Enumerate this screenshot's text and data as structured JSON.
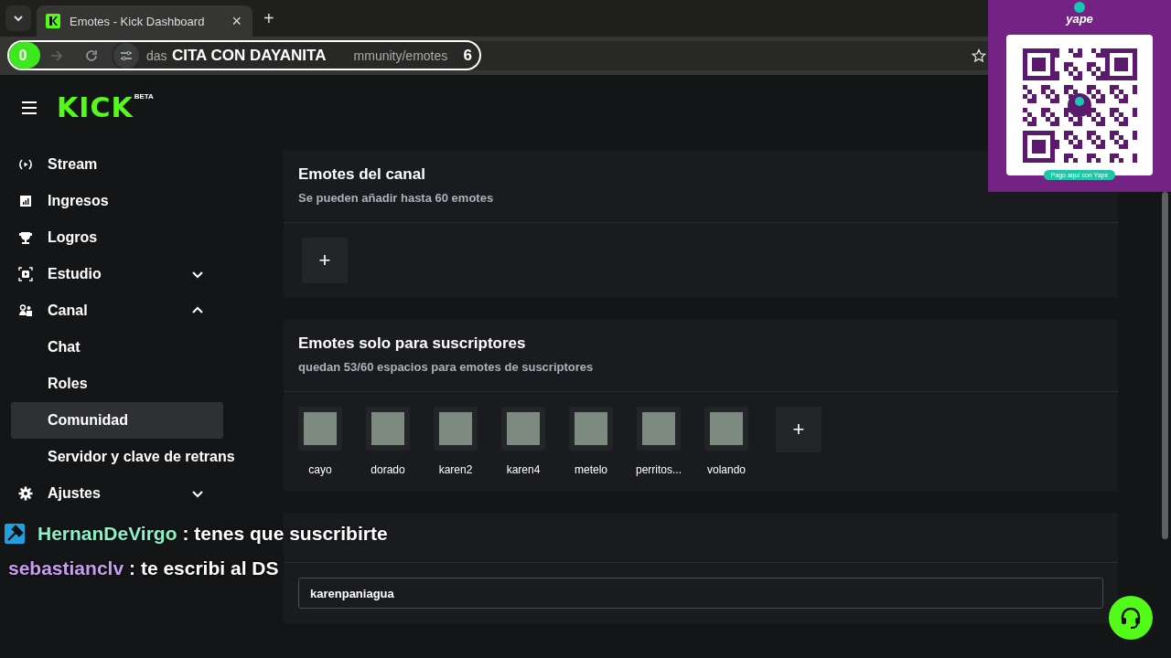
{
  "browser": {
    "tab": {
      "title": "Emotes - Kick Dashboard",
      "close": "×",
      "new_tab": "+"
    },
    "url_start": "das",
    "url_end": "mmunity/emotes"
  },
  "site": {
    "logo": "KICK",
    "badge": "BETA"
  },
  "sidebar": {
    "items": [
      {
        "label": "Stream"
      },
      {
        "label": "Ingresos"
      },
      {
        "label": "Logros"
      },
      {
        "label": "Estudio",
        "expanded": false
      },
      {
        "label": "Canal",
        "expanded": true,
        "children": [
          {
            "label": "Chat",
            "selected": false
          },
          {
            "label": "Roles",
            "selected": false
          },
          {
            "label": "Comunidad",
            "selected": true
          },
          {
            "label": "Servidor y clave de retrans",
            "selected": false
          }
        ]
      },
      {
        "label": "Ajustes",
        "expanded": false
      }
    ]
  },
  "sections": [
    {
      "title": "Emotes del canal",
      "subtitle": "Se pueden añadir hasta 60 emotes",
      "add_label": "+"
    },
    {
      "title": "Emotes solo para suscriptores",
      "subtitle": "quedan 53/60 espacios para emotes de suscriptores",
      "emotes": [
        {
          "name": "cayo"
        },
        {
          "name": "dorado"
        },
        {
          "name": "karen2"
        },
        {
          "name": "karen4"
        },
        {
          "name": "metelo"
        },
        {
          "name": "perritos..."
        },
        {
          "name": "volando"
        }
      ],
      "add_label": "+"
    },
    {
      "input_value": "karenpaniagua"
    }
  ],
  "overlays": {
    "goal": {
      "title": "CITA CON DAYANITA",
      "current": "0",
      "target": "6",
      "level": 0
    },
    "yape": {
      "logo": "yape",
      "caption": "Pago aquí con Yape"
    },
    "chat": [
      {
        "user": "HernanDeVirgo",
        "message": ": tenes que suscribirte",
        "color": "#8ef0c8",
        "badge": true
      },
      {
        "user": "sebastianclv",
        "message": ": te escribi al DS",
        "color": "#c79df0",
        "badge": false
      }
    ]
  }
}
